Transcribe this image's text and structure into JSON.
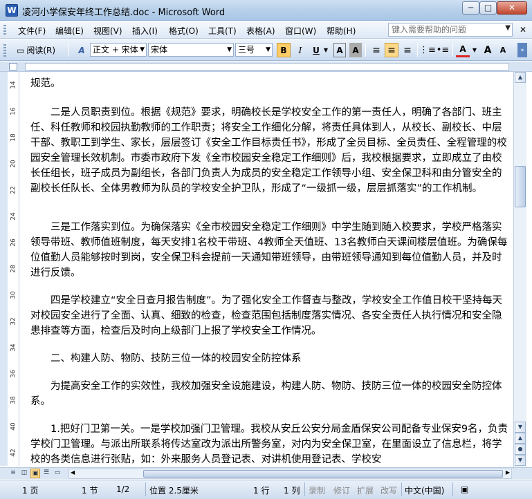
{
  "window": {
    "title": "凌河小学保安年终工作总结.doc - Microsoft Word",
    "minimize": "─",
    "maximize": "□",
    "close": "✕"
  },
  "menu": {
    "items": [
      "文件(F)",
      "编辑(E)",
      "视图(V)",
      "插入(I)",
      "格式(O)",
      "工具(T)",
      "表格(A)",
      "窗口(W)",
      "帮助(H)"
    ],
    "help_placeholder": "键入需要帮助的问题"
  },
  "toolbar": {
    "reading_label": "阅读(R)",
    "style_value": "正文 + 宋体",
    "font_value": "宋体",
    "size_value": "三号",
    "bold": "B",
    "italic": "I",
    "underline": "U",
    "font_color_label": "A",
    "grow_font": "A",
    "shrink_font": "A"
  },
  "document": {
    "paragraphs": [
      "规范。",
      "",
      "　　二是人员职责到位。根据《规范》要求，明确校长是学校安全工作的第一责任人，明确了各部门、班主任、科任教师和校园执勤教师的工作职责；将安全工作细化分解，将责任具体到人，从校长、副校长、中层干部、教职工到学生、家长，层层签订《安全工作目标责任书》，形成了全员目标、全员责任、全程管理的校园安全管理长效机制。市委市政府下发《全市校园安全稳定工作细则》后，我校根据要求，立即成立了由校长任组长，班子成员为副组长，各部门负责人为成员的安全稳定工作领导小组、安全保卫科和由分管安全的副校长任队长、全体男教师为队员的学校安全护卫队，形成了“一级抓一级，层层抓落实”的工作机制。",
      "",
      "　　三是工作落实到位。为确保落实《全市校园安全稳定工作细则》中学生随到随入校要求，学校严格落实领导带班、教师值班制度，每天安排1名校干带班、4教师全天值班、13名教师白天课间楼层值班。为确保每位值勤人员能够按时到岗，安全保卫科会提前一天通知带班领导，由带班领导通知到每位值勤人员，并及时进行反馈。",
      "",
      "　　四是学校建立“安全日查月报告制度”。为了强化安全工作督查与整改，学校安全工作值日校干坚持每天对校园安全进行了全面、认真、细致的检查，检查范围包括制度落实情况、各安全责任人执行情况和安全隐患排查等方面，检查后及时向上级部门上报了学校安全工作情况。",
      "",
      "　　二、构建人防、物防、技防三位一体的校园安全防控体系",
      "",
      "　　为提高安全工作的实效性，我校加强安全设施建设，构建人防、物防、技防三位一体的校园安全防控体系。",
      "",
      "　　1.把好门卫第一关。一是学校加强门卫管理。我校从安丘公安分局金盾保安公司配备专业保安9名，负责学校门卫管理。与派出所联系将传达室改为派出所警务室，对内为安全保卫室，在里面设立了信息栏，将学校的各类信息进行张贴，如：外来服务人员登记表、对讲机使用登记表、学校安"
    ]
  },
  "vruler_numbers": [
    "14",
    "16",
    "18",
    "20",
    "22",
    "24",
    "26",
    "28",
    "30",
    "32",
    "34",
    "36",
    "38",
    "40",
    "42"
  ],
  "statusbar": {
    "page": "1 页",
    "section": "1 节",
    "page_of": "1/2",
    "position": "位置 2.5厘米",
    "line": "1 行",
    "column": "1 列",
    "rec": "录制",
    "trk": "修订",
    "ext": "扩展",
    "ovr": "改写",
    "language": "中文(中国)"
  }
}
